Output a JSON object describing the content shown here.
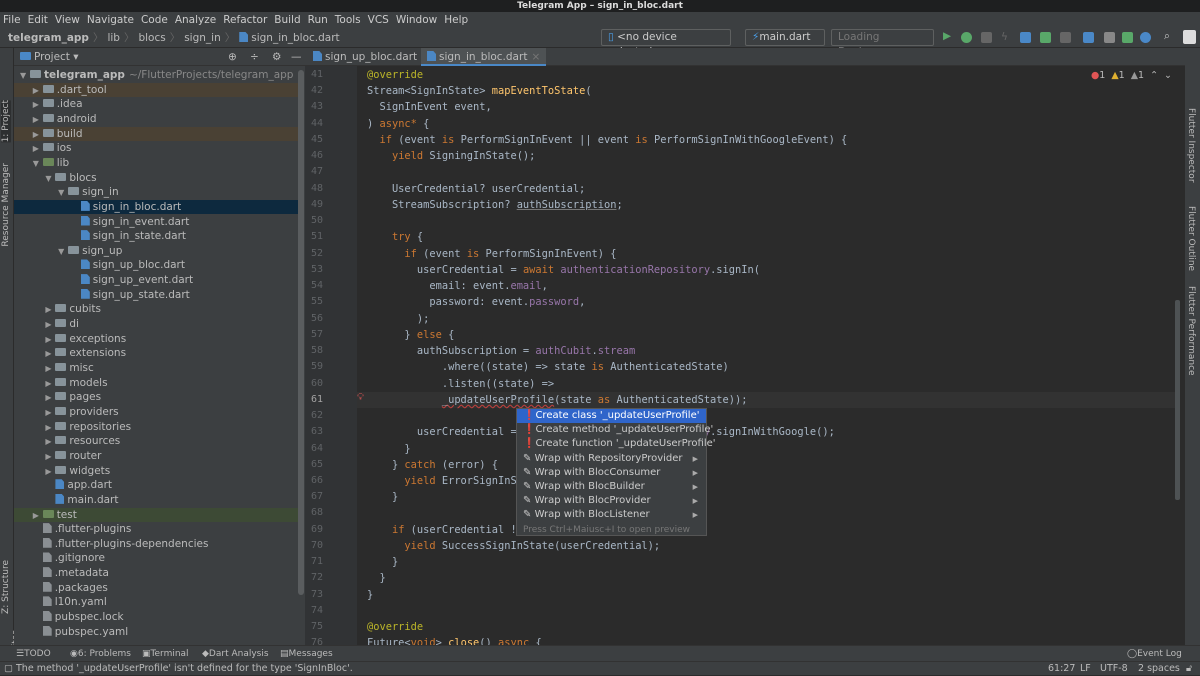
{
  "window": {
    "title": "Telegram App – sign_in_bloc.dart"
  },
  "menu": [
    "File",
    "Edit",
    "View",
    "Navigate",
    "Code",
    "Analyze",
    "Refactor",
    "Build",
    "Run",
    "Tools",
    "VCS",
    "Window",
    "Help"
  ],
  "breadcrumb": [
    "telegram_app",
    "lib",
    "blocs",
    "sign_in",
    "sign_in_bloc.dart"
  ],
  "toolbar": {
    "device": "<no device selected>",
    "run_config": "main.dart",
    "devices_loading": "Loading Devices..."
  },
  "project_panel": {
    "title": "Project",
    "side_tab": "1: Project",
    "side_tabs": [
      "Resource Manager",
      "Z: Structure",
      "2: Favorites"
    ],
    "tree": [
      {
        "label": "telegram_app",
        "hint": "~/FlutterProjects/telegram_app",
        "level": 0,
        "type": "folder",
        "open": true
      },
      {
        "label": ".dart_tool",
        "level": 1,
        "type": "folder",
        "style": "excluded"
      },
      {
        "label": ".idea",
        "level": 1,
        "type": "folder"
      },
      {
        "label": "android",
        "level": 1,
        "type": "folder"
      },
      {
        "label": "build",
        "level": 1,
        "type": "folder",
        "style": "excluded"
      },
      {
        "label": "ios",
        "level": 1,
        "type": "folder"
      },
      {
        "label": "lib",
        "level": 1,
        "type": "folder",
        "open": true
      },
      {
        "label": "blocs",
        "level": 2,
        "type": "folder",
        "open": true
      },
      {
        "label": "sign_in",
        "level": 3,
        "type": "folder",
        "open": true
      },
      {
        "label": "sign_in_bloc.dart",
        "level": 4,
        "type": "dart",
        "style": "selected"
      },
      {
        "label": "sign_in_event.dart",
        "level": 4,
        "type": "dart"
      },
      {
        "label": "sign_in_state.dart",
        "level": 4,
        "type": "dart"
      },
      {
        "label": "sign_up",
        "level": 3,
        "type": "folder",
        "open": true
      },
      {
        "label": "sign_up_bloc.dart",
        "level": 4,
        "type": "dart"
      },
      {
        "label": "sign_up_event.dart",
        "level": 4,
        "type": "dart"
      },
      {
        "label": "sign_up_state.dart",
        "level": 4,
        "type": "dart"
      },
      {
        "label": "cubits",
        "level": 2,
        "type": "folder"
      },
      {
        "label": "di",
        "level": 2,
        "type": "folder"
      },
      {
        "label": "exceptions",
        "level": 2,
        "type": "folder"
      },
      {
        "label": "extensions",
        "level": 2,
        "type": "folder"
      },
      {
        "label": "misc",
        "level": 2,
        "type": "folder"
      },
      {
        "label": "models",
        "level": 2,
        "type": "folder"
      },
      {
        "label": "pages",
        "level": 2,
        "type": "folder"
      },
      {
        "label": "providers",
        "level": 2,
        "type": "folder"
      },
      {
        "label": "repositories",
        "level": 2,
        "type": "folder"
      },
      {
        "label": "resources",
        "level": 2,
        "type": "folder"
      },
      {
        "label": "router",
        "level": 2,
        "type": "folder"
      },
      {
        "label": "widgets",
        "level": 2,
        "type": "folder"
      },
      {
        "label": "app.dart",
        "level": 2,
        "type": "dart"
      },
      {
        "label": "main.dart",
        "level": 2,
        "type": "dart"
      },
      {
        "label": "test",
        "level": 1,
        "type": "folder",
        "style": "test"
      },
      {
        "label": ".flutter-plugins",
        "level": 1,
        "type": "file"
      },
      {
        "label": ".flutter-plugins-dependencies",
        "level": 1,
        "type": "file"
      },
      {
        "label": ".gitignore",
        "level": 1,
        "type": "file"
      },
      {
        "label": ".metadata",
        "level": 1,
        "type": "file"
      },
      {
        "label": ".packages",
        "level": 1,
        "type": "file"
      },
      {
        "label": "l10n.yaml",
        "level": 1,
        "type": "file"
      },
      {
        "label": "pubspec.lock",
        "level": 1,
        "type": "file"
      },
      {
        "label": "pubspec.yaml",
        "level": 1,
        "type": "file"
      }
    ]
  },
  "tabs": [
    {
      "label": "sign_up_bloc.dart",
      "active": false
    },
    {
      "label": "sign_in_bloc.dart",
      "active": true
    }
  ],
  "inspections": {
    "errors": "1",
    "warnings": "1",
    "weak_warnings": "1"
  },
  "editor": {
    "first_line": 41,
    "current_line": 61,
    "lines": [
      [
        [
          "@override",
          "a"
        ]
      ],
      [
        [
          "Stream<SignInState> ",
          ""
        ],
        [
          "mapEventToState",
          "f"
        ],
        [
          "(",
          ""
        ]
      ],
      [
        [
          "  SignInEvent event,",
          ""
        ]
      ],
      [
        [
          ") ",
          ""
        ],
        [
          "async*",
          "k"
        ],
        [
          " {",
          ""
        ]
      ],
      [
        [
          "  ",
          ""
        ],
        [
          "if",
          "k"
        ],
        [
          " (event ",
          ""
        ],
        [
          "is",
          "k"
        ],
        [
          " PerformSignInEvent || event ",
          ""
        ],
        [
          "is",
          "k"
        ],
        [
          " PerformSignInWithGoogleEvent) {",
          ""
        ]
      ],
      [
        [
          "    ",
          ""
        ],
        [
          "yield",
          "k"
        ],
        [
          " SigningInState();",
          ""
        ]
      ],
      [],
      [
        [
          "    UserCredential? userCredential;",
          ""
        ]
      ],
      [
        [
          "    StreamSubscription? ",
          ""
        ],
        [
          "authSubscription",
          "g"
        ],
        [
          ";",
          ""
        ]
      ],
      [],
      [
        [
          "    ",
          ""
        ],
        [
          "try",
          "k"
        ],
        [
          " {",
          ""
        ]
      ],
      [
        [
          "      ",
          ""
        ],
        [
          "if",
          "k"
        ],
        [
          " (event ",
          ""
        ],
        [
          "is",
          "k"
        ],
        [
          " PerformSignInEvent) {",
          ""
        ]
      ],
      [
        [
          "        userCredential = ",
          ""
        ],
        [
          "await",
          "k"
        ],
        [
          " ",
          ""
        ],
        [
          "authenticationRepository",
          "p"
        ],
        [
          ".signIn(",
          ""
        ]
      ],
      [
        [
          "          email: event.",
          ""
        ],
        [
          "email",
          "p"
        ],
        [
          ",",
          ""
        ]
      ],
      [
        [
          "          password: event.",
          ""
        ],
        [
          "password",
          "p"
        ],
        [
          ",",
          ""
        ]
      ],
      [
        [
          "        );",
          ""
        ]
      ],
      [
        [
          "      } ",
          ""
        ],
        [
          "else",
          "k"
        ],
        [
          " {",
          ""
        ]
      ],
      [
        [
          "        authSubscription = ",
          ""
        ],
        [
          "authCubit",
          "p"
        ],
        [
          ".",
          ""
        ],
        [
          "stream",
          "p"
        ]
      ],
      [
        [
          "            .where((state) => state ",
          ""
        ],
        [
          "is",
          "k"
        ],
        [
          " AuthenticatedState)",
          ""
        ]
      ],
      [
        [
          "            .listen((state) =>",
          ""
        ]
      ],
      [
        [
          "            ",
          ""
        ],
        [
          "_updateUserProfile",
          "u"
        ],
        [
          "(state ",
          ""
        ],
        [
          "as",
          "k"
        ],
        [
          " AuthenticatedState));",
          ""
        ]
      ],
      [],
      [
        [
          "        userCredential = ",
          ""
        ],
        [
          "await",
          "k"
        ],
        [
          " ",
          ""
        ],
        [
          "authenticationRepository",
          "p"
        ],
        [
          ".signInWithGoogle();",
          ""
        ]
      ],
      [
        [
          "      }",
          ""
        ]
      ],
      [
        [
          "    } ",
          ""
        ],
        [
          "catch",
          "k"
        ],
        [
          " (error) {",
          ""
        ]
      ],
      [
        [
          "      ",
          ""
        ],
        [
          "yield",
          "k"
        ],
        [
          " ErrorSignInState();",
          ""
        ]
      ],
      [
        [
          "    }",
          ""
        ]
      ],
      [],
      [
        [
          "    ",
          ""
        ],
        [
          "if",
          "k"
        ],
        [
          " (userCredential != ",
          ""
        ],
        [
          "null",
          "k"
        ],
        [
          ") {",
          ""
        ]
      ],
      [
        [
          "      ",
          ""
        ],
        [
          "yield",
          "k"
        ],
        [
          " SuccessSignInState(userCredential);",
          ""
        ]
      ],
      [
        [
          "    }",
          ""
        ]
      ],
      [
        [
          "  }",
          ""
        ]
      ],
      [
        [
          "}",
          ""
        ]
      ],
      [],
      [
        [
          "@override",
          "a"
        ]
      ],
      [
        [
          "Future<",
          ""
        ],
        [
          "void",
          "k"
        ],
        [
          "> ",
          ""
        ],
        [
          "close",
          "f"
        ],
        [
          "() ",
          ""
        ],
        [
          "async",
          "k"
        ],
        [
          " {",
          ""
        ]
      ]
    ]
  },
  "intention_popup": {
    "items": [
      {
        "label": "Create class '_updateUserProfile'",
        "icon": "bulb-error-icon",
        "selected": true,
        "submenu": false
      },
      {
        "label": "Create method '_updateUserProfile'",
        "icon": "bulb-error-icon",
        "submenu": false
      },
      {
        "label": "Create function '_updateUserProfile'",
        "icon": "bulb-error-icon",
        "submenu": false
      },
      {
        "label": "Wrap with RepositoryProvider",
        "icon": "wrap-icon",
        "submenu": true
      },
      {
        "label": "Wrap with BlocConsumer",
        "icon": "wrap-icon",
        "submenu": true
      },
      {
        "label": "Wrap with BlocBuilder",
        "icon": "wrap-icon",
        "submenu": true
      },
      {
        "label": "Wrap with BlocProvider",
        "icon": "wrap-icon",
        "submenu": true
      },
      {
        "label": "Wrap with BlocListener",
        "icon": "wrap-icon",
        "submenu": true
      }
    ],
    "hint": "Press Ctrl+Maiusc+I to open preview"
  },
  "right_tabs": [
    "Flutter Inspector",
    "Flutter Outline",
    "Flutter Performance"
  ],
  "bottom_tabs": [
    "TODO",
    "6: Problems",
    "Terminal",
    "Dart Analysis",
    "Messages"
  ],
  "event_log": "Event Log",
  "status": {
    "message": "The method '_updateUserProfile' isn't defined for the type 'SignInBloc'.",
    "position": "61:27",
    "line_sep": "LF",
    "encoding": "UTF-8",
    "indent": "2 spaces"
  },
  "colors": {
    "accent": "#2f65ca",
    "error": "#e05555",
    "warning": "#e0b030"
  }
}
